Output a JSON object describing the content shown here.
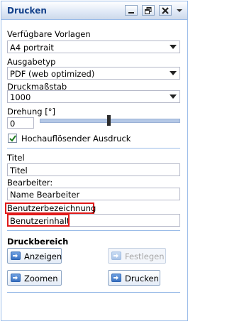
{
  "panel": {
    "title": "Drucken",
    "tools": [
      {
        "name": "minimize",
        "icon": "minimize-icon"
      },
      {
        "name": "restore",
        "icon": "restore-icon"
      },
      {
        "name": "close",
        "icon": "close-icon"
      },
      {
        "name": "menu",
        "icon": "chevron-down-icon"
      }
    ]
  },
  "form": {
    "vorlagen_label": "Verfügbare Vorlagen",
    "vorlagen_value": "A4 portrait",
    "ausgabetyp_label": "Ausgabetyp",
    "ausgabetyp_value": "PDF (web optimized)",
    "massstab_label": "Druckmaßstab",
    "massstab_value": "1000",
    "drehung_label": "Drehung [°]",
    "drehung_value": "0",
    "drehung_slider_fraction": 0.49,
    "hochaufloesend_label": "Hochauflösender Ausdruck",
    "hochaufloesend_checked": true,
    "titel_label": "Titel",
    "titel_value": "Titel",
    "bearbeiter_label": "Bearbeiter:",
    "bearbeiter_value": "Name Bearbeiter",
    "benutzer_label": "Benutzerbezeichnung",
    "benutzer_value": "Benutzerinhalt"
  },
  "druckbereich": {
    "title": "Druckbereich",
    "anzeigen_label": "Anzeigen",
    "festlegen_label": "Festlegen",
    "festlegen_enabled": false,
    "zoomen_label": "Zoomen",
    "drucken_label": "Drucken"
  },
  "colors": {
    "title_text": "#15428b",
    "border": "#99bbe8",
    "highlight": "#e01a1a",
    "button_icon": "#3a72c2"
  }
}
